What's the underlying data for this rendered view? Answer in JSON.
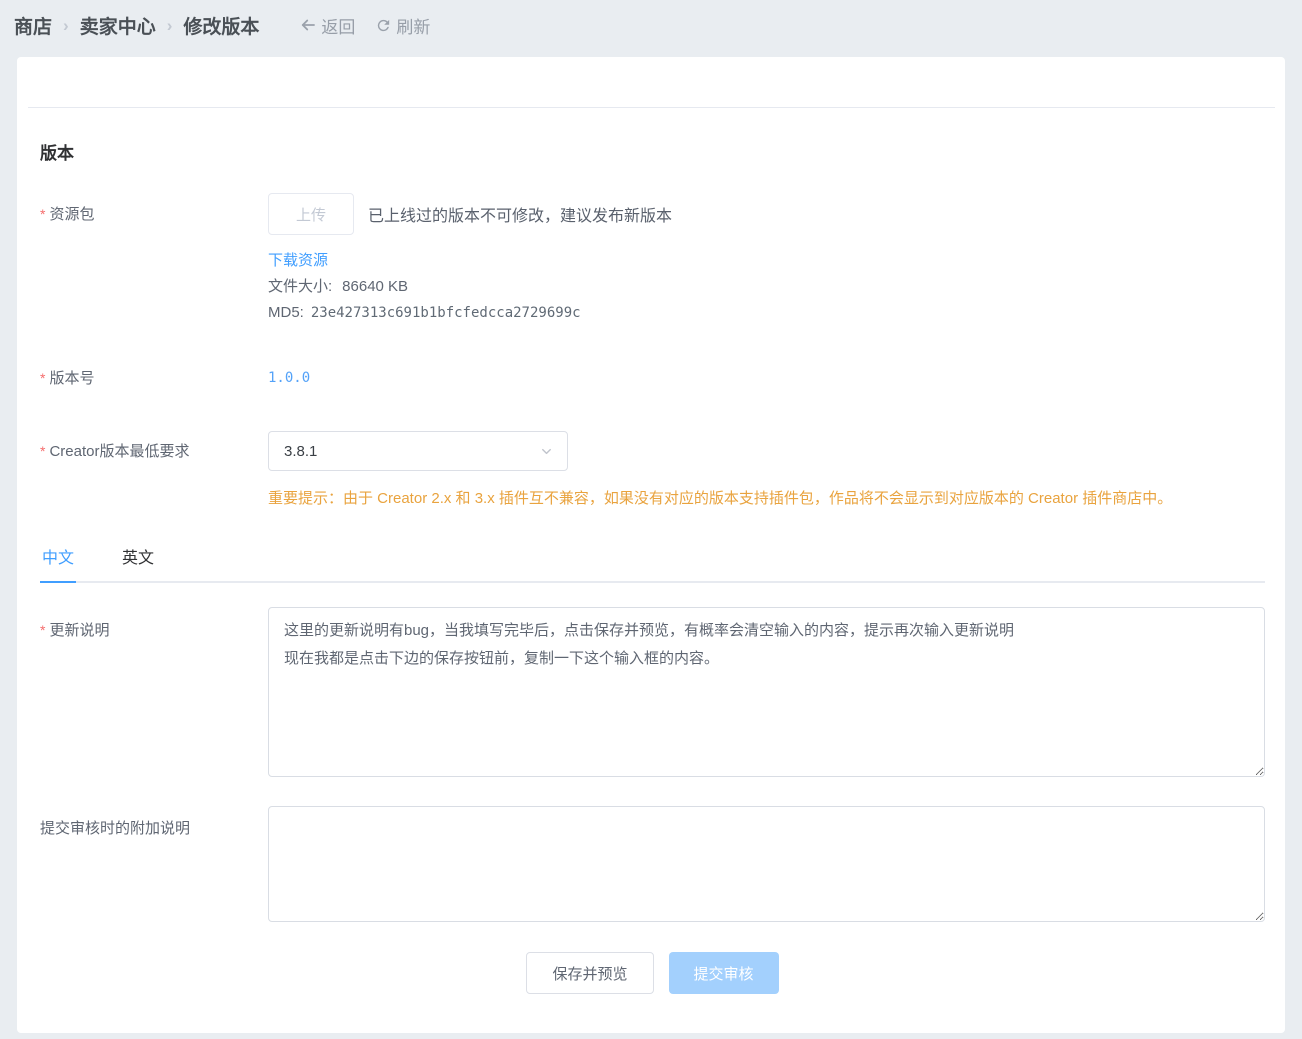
{
  "breadcrumb": {
    "items": [
      "商店",
      "卖家中心",
      "修改版本"
    ],
    "separator": "›",
    "back_label": "返回",
    "refresh_label": "刷新"
  },
  "section": {
    "title": "版本"
  },
  "form": {
    "required_marker": "*",
    "resource": {
      "label": "资源包",
      "upload_button": "上传",
      "hint": "已上线过的版本不可修改，建议发布新版本",
      "download_link": "下载资源",
      "file_size_label": "文件大小:",
      "file_size_value": "86640 KB",
      "md5_label": "MD5:",
      "md5_value": "23e427313c691b1bfcfedcca2729699c"
    },
    "version": {
      "label": "版本号",
      "value": "1.0.0"
    },
    "creator_min": {
      "label": "Creator版本最低要求",
      "selected": "3.8.1",
      "warning": "重要提示：由于 Creator 2.x 和 3.x 插件互不兼容，如果没有对应的版本支持插件包，作品将不会显示到对应版本的 Creator 插件商店中。"
    },
    "tabs": [
      {
        "label": "中文",
        "active": true
      },
      {
        "label": "英文",
        "active": false
      }
    ],
    "update_notes": {
      "label": "更新说明",
      "value": "这里的更新说明有bug，当我填写完毕后，点击保存并预览，有概率会清空输入的内容，提示再次输入更新说明\n现在我都是点击下边的保存按钮前，复制一下这个输入框的内容。"
    },
    "extra_notes": {
      "label": "提交审核时的附加说明",
      "value": ""
    }
  },
  "actions": {
    "save_preview": "保存并预览",
    "submit_review": "提交审核"
  },
  "colors": {
    "accent_blue": "#409eff",
    "warning_orange": "#e6a23c",
    "required_red": "#f56c6c",
    "submit_button_bg": "#a0cfff",
    "page_background": "#e9edf1"
  }
}
